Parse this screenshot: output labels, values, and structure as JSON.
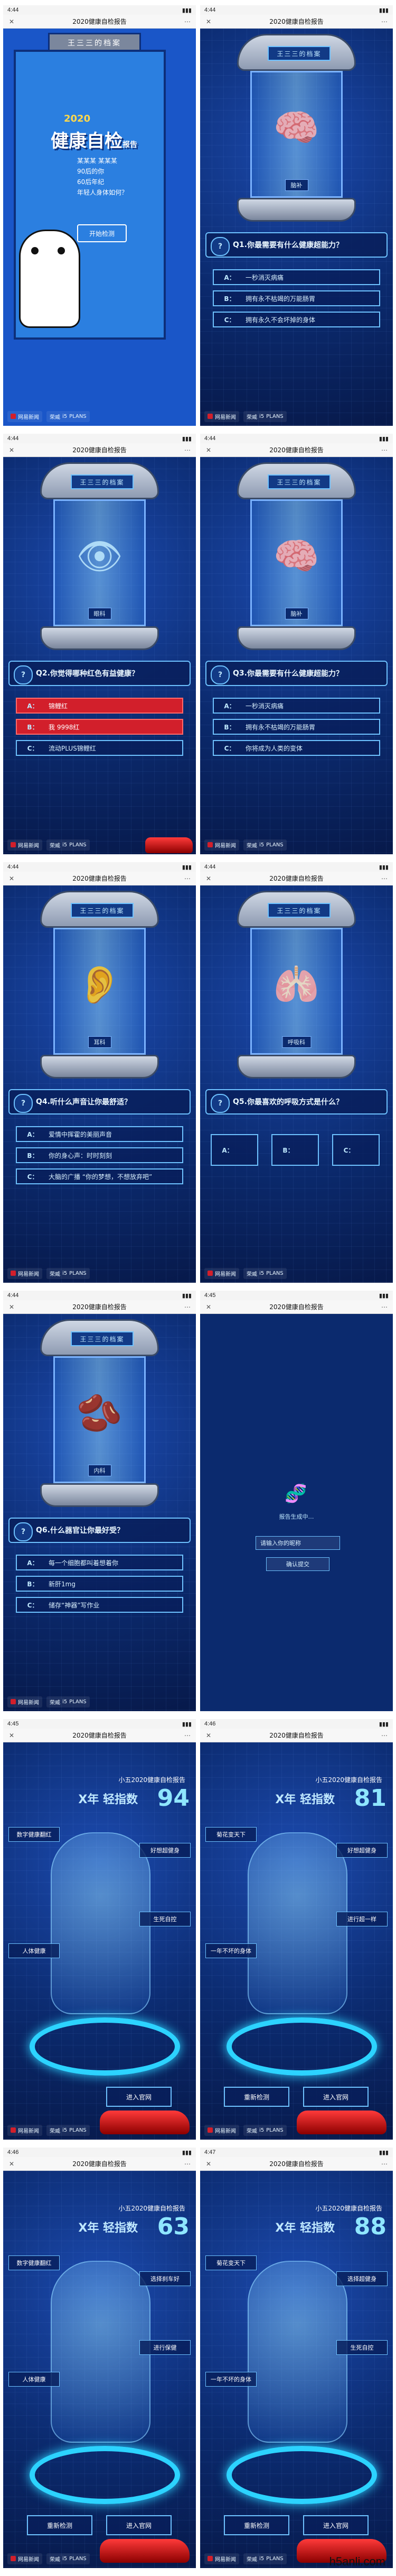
{
  "page": {
    "title": "2020健康自检报告",
    "watermark": "h5anli.com"
  },
  "status_times": [
    "4:44",
    "4:44",
    "4:44",
    "4:44",
    "4:44",
    "4:44",
    "4:44",
    "4:45",
    "4:45",
    "4:46",
    "4:46",
    "4:47"
  ],
  "footer": {
    "brand1": "网易新闻",
    "brand2": "荣威",
    "brand3": "i5",
    "brand4": "PLANS"
  },
  "cover": {
    "sign": "王三三的档案",
    "year": "2020",
    "title": "健康自检",
    "title_suffix": "报告",
    "lines": [
      "某某某 某某某",
      "90后的你",
      "60后年纪",
      "年轻人身体如何？"
    ],
    "start_button": "开始检测"
  },
  "quiz": [
    {
      "tag": "脑补",
      "organ": "🧠",
      "q_no": "Q1.",
      "question": "你最需要有什么健康超能力？",
      "options": [
        {
          "k": "A：",
          "t": "一秒消灭病痛",
          "sel": false
        },
        {
          "k": "B：",
          "t": "拥有永不枯竭的万能肠胃",
          "sel": false
        },
        {
          "k": "C：",
          "t": "拥有永久不会坏掉的身体",
          "sel": false
        }
      ]
    },
    {
      "tag": "眼科",
      "organ": "👁",
      "q_no": "Q2.",
      "question": "你觉得哪种红色有益健康？",
      "options": [
        {
          "k": "A：",
          "t": "锦鲤红",
          "sel": true
        },
        {
          "k": "B：",
          "t": "我 9998红",
          "sel": true
        },
        {
          "k": "C：",
          "t": "流动PLUS锦鲤红",
          "sel": false
        }
      ]
    },
    {
      "tag": "脑补",
      "organ": "🧠",
      "q_no": "Q3.",
      "question": "你最需要有什么健康超能力？",
      "options": [
        {
          "k": "A：",
          "t": "一秒消灭病痛",
          "sel": false
        },
        {
          "k": "B：",
          "t": "拥有永不枯竭的万能肠胃",
          "sel": false
        },
        {
          "k": "C：",
          "t": "你将成为人类的变体",
          "sel": false
        }
      ]
    },
    {
      "tag": "耳科",
      "organ": "👂",
      "q_no": "Q4.",
      "question": "听什么声音让你最舒适？",
      "options": [
        {
          "k": "A：",
          "t": "爱情中挥霍的美丽声音",
          "sel": false
        },
        {
          "k": "B：",
          "t": "你的身心声：时时刻刻",
          "sel": false
        },
        {
          "k": "C：",
          "t": "大脑的广播 “你的梦想，不想放弃吧”",
          "sel": false
        }
      ]
    },
    {
      "tag": "呼吸科",
      "organ": "🫁",
      "q_no": "Q5.",
      "question": "你最喜欢的呼吸方式是什么？",
      "options": [
        {
          "k": "A：",
          "t": "",
          "sel": false
        },
        {
          "k": "B：",
          "t": "",
          "sel": false
        },
        {
          "k": "C：",
          "t": "",
          "sel": false
        }
      ]
    },
    {
      "tag": "内科",
      "organ": "🫘",
      "q_no": "Q6.",
      "question": "什么器官让你最好受？",
      "options": [
        {
          "k": "A：",
          "t": "每一个细胞都叫着想着你",
          "sel": false
        },
        {
          "k": "B：",
          "t": "新肝1mg",
          "sel": false
        },
        {
          "k": "C：",
          "t": "储存“神器”写作业",
          "sel": false
        }
      ]
    }
  ],
  "loading": {
    "text": "报告生成中…",
    "name_field": "请输入你的昵称",
    "confirm": "确认提交"
  },
  "results": [
    {
      "title": "小五2020健康自检报告",
      "age": "X年 轻指数",
      "score": "94",
      "bubbles": [
        "数字健康翻红",
        "好想超健身",
        "人体健康",
        "生死自控"
      ],
      "btn_left": "",
      "btn_right": "进入官网"
    },
    {
      "title": "小五2020健康自检报告",
      "age": "X年 轻指数",
      "score": "81",
      "bubbles": [
        "菊花变天下",
        "好想超健身",
        "一年不坏的身体",
        "进行超一样"
      ],
      "btn_left": "重新检测",
      "btn_right": "进入官网"
    },
    {
      "title": "小五2020健康自检报告",
      "age": "X年 轻指数",
      "score": "63",
      "bubbles": [
        "数字健康翻红",
        "选择刹车好",
        "人体健康",
        "进行保健"
      ],
      "btn_left": "重新检测",
      "btn_right": "进入官网"
    },
    {
      "title": "小五2020健康自检报告",
      "age": "X年 轻指数",
      "score": "88",
      "bubbles": [
        "菊花变天下",
        "选择超健身",
        "一年不坏的身体",
        "生死自控"
      ],
      "btn_left": "重新检测",
      "btn_right": "进入官网"
    }
  ]
}
